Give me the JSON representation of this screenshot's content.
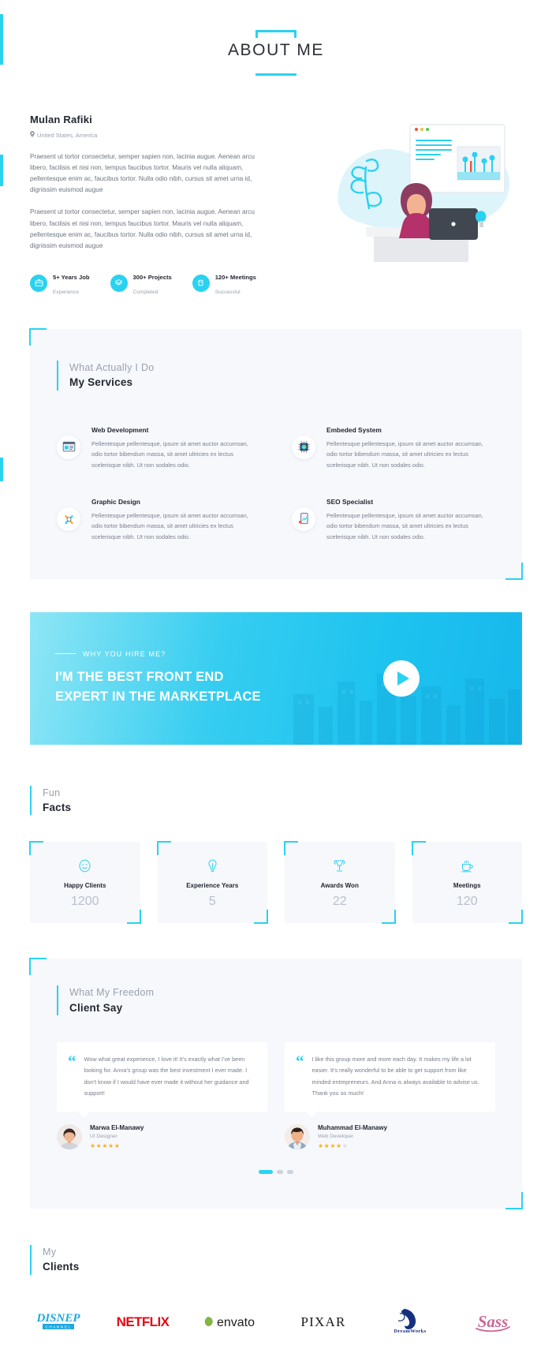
{
  "page": {
    "title": "ABOUT ME"
  },
  "about": {
    "name": "Mulan Rafiki",
    "location": "United States, America",
    "location_icon": "map-pin-icon",
    "paragraph1": "Praesent ut tortor consectetur, semper sapien non, lacinia augue. Aenean arcu libero, facilisis et nisi non, tempus faucibus tortor. Mauris vel nulla aliquam, pellentesque enim ac, faucibus tortor. Nulla odio nibh, cursus sit amet urna id, dignissim euismod augue",
    "paragraph2": "Praesent ut tortor consectetur, semper sapien non, lacinia augue. Aenean arcu libero, facilisis et nisi non, tempus faucibus tortor. Mauris vel nulla aliquam, pellentesque enim ac, faucibus tortor. Nulla odio nibh, cursus sit amet urna id, dignissim euismod augue",
    "stats": [
      {
        "title": "5+ Years Job",
        "subtitle": "Experience",
        "icon": "briefcase-icon"
      },
      {
        "title": "300+ Projects",
        "subtitle": "Completed",
        "icon": "layers-icon"
      },
      {
        "title": "120+ Meetings",
        "subtitle": "Successful",
        "icon": "cup-icon"
      }
    ]
  },
  "services": {
    "kicker": "What Actually I Do",
    "title": "My Services",
    "items": [
      {
        "title": "Web Development",
        "icon": "browser-code-icon",
        "desc": "Pellentesque pellentesque, ipsum sit amet auctor accumsan, odio tortor bibendum massa, sit amet ultricies ex lectus scelerisque nibh. Ut non sodales odio."
      },
      {
        "title": "Embeded System",
        "icon": "microchip-icon",
        "desc": "Pellentesque pellentesque, ipsum sit amet auctor accumsan, odio tortor bibendum massa, sit amet ultricies ex lectus scelerisque nibh. Ut non sodales odio."
      },
      {
        "title": "Graphic Design",
        "icon": "pencil-ruler-icon",
        "desc": "Pellentesque pellentesque, ipsum sit amet auctor accumsan, odio tortor bibendum massa, sit amet ultricies ex lectus scelerisque nibh. Ut non sodales odio."
      },
      {
        "title": "SEO Specialist",
        "icon": "mobile-chart-icon",
        "desc": "Pellentesque pellentesque, ipsum sit amet auctor accumsan, odio tortor bibendum massa, sit amet ultricies ex lectus scelerisque nibh. Ut non sodales odio."
      }
    ]
  },
  "hire": {
    "kicker": "WHY YOU HIRE ME?",
    "headline_line1": "I'M THE BEST FRONT END",
    "headline_line2": "EXPERT IN THE MARKETPLACE",
    "play_icon": "play-icon"
  },
  "facts": {
    "kicker": "Fun",
    "title": "Facts",
    "items": [
      {
        "label": "Happy Clients",
        "value": "1200",
        "icon": "smiley-icon"
      },
      {
        "label": "Experience Years",
        "value": "5",
        "icon": "lightbulb-icon"
      },
      {
        "label": "Awards Won",
        "value": "22",
        "icon": "trophy-icon"
      },
      {
        "label": "Meetings",
        "value": "120",
        "icon": "coffee-cup-icon"
      }
    ]
  },
  "testimonials": {
    "kicker": "What My Freedom",
    "title": "Client Say",
    "quote_icon": "quote-icon",
    "items": [
      {
        "text": "Wow what great experience, I love it! It's exactly what I've been looking for. Anna's group was the best investment I ever made. I don't know if I would have ever made it without her guidance and support!",
        "name": "Marwa El-Manawy",
        "role": "UI Designer",
        "stars_filled": 5,
        "stars_total": 5
      },
      {
        "text": "I like this group more and more each day. It makes my life a lot easier. It's really wonderful to be able to get support from like minded entrepreneurs. And Anna is always available to advise us. Thank you so much!",
        "name": "Muhammad El-Manawy",
        "role": "Web Developer",
        "stars_filled": 4,
        "stars_total": 5
      }
    ],
    "pagination": {
      "active_index": 0,
      "count": 3
    }
  },
  "clients": {
    "kicker": "My",
    "title": "Clients",
    "logos": [
      {
        "name": "Disney Channel",
        "text": "DISNEP",
        "sub": "CHANNEL",
        "color": "#1fa9e0"
      },
      {
        "name": "NETFLIX",
        "text": "NETFLIX",
        "color": "#e50914"
      },
      {
        "name": "envato",
        "text": "envato",
        "color": "#1d1d1b"
      },
      {
        "name": "PIXAR",
        "text": "PIXAR",
        "color": "#1a1a1a"
      },
      {
        "name": "DreamWorks",
        "text": "DreamWorks",
        "color": "#15317e"
      },
      {
        "name": "Sass",
        "text": "Sass",
        "color": "#cc6699"
      }
    ]
  },
  "theme": {
    "accent": "#2ad2f0",
    "panel_bg": "#f6f8fc",
    "text_dark": "#232730",
    "text_muted": "#9aa1ad",
    "star": "#f5b127"
  }
}
